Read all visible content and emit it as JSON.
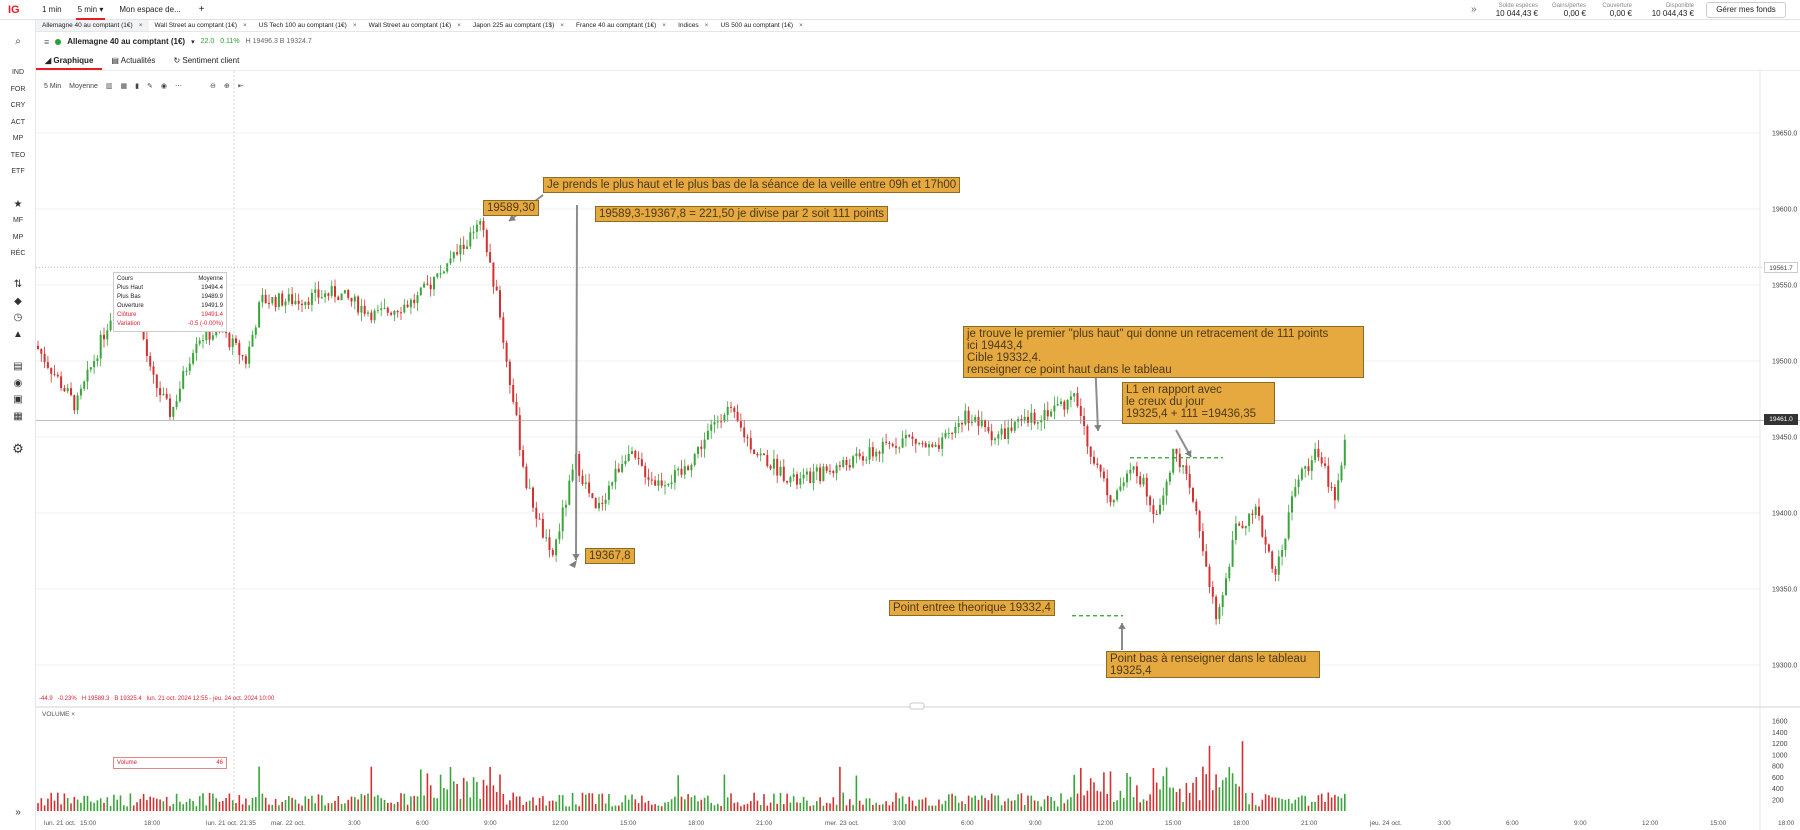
{
  "app": {
    "logo": "IG"
  },
  "topbar": {
    "timeframes": [
      "1 min",
      "5 min"
    ],
    "active_timeframe": "5 min",
    "workspace": "Mon espace de...",
    "add": "+",
    "more": "»",
    "account": [
      {
        "label": "Solde espèces",
        "value": "10 044,43 €"
      },
      {
        "label": "Gains/pertes",
        "value": "0,00 €"
      },
      {
        "label": "Couverture",
        "value": "0,00 €"
      },
      {
        "label": "Disponible",
        "value": "10 044,43 €"
      }
    ],
    "fund_button": "Gérer mes fonds"
  },
  "tabs": [
    {
      "label": "Allemagne 40 au comptant (1€)",
      "close": "×"
    },
    {
      "label": "Wall Street au comptant (1€)",
      "close": "×"
    },
    {
      "label": "US Tech 100 au comptant (1€)",
      "close": "×"
    },
    {
      "label": "Wall Street au comptant (1€)",
      "close": "×"
    },
    {
      "label": "Japon 225 au comptant (1$)",
      "close": "×"
    },
    {
      "label": "France 40 au comptant (1€)",
      "close": "×"
    },
    {
      "label": "Indices",
      "close": "×"
    },
    {
      "label": "US 500 au comptant (1€)",
      "close": "×"
    }
  ],
  "sidebar": {
    "items": [
      "IND",
      "FOR",
      "CRY",
      "ACT",
      "MP",
      "TEO",
      "ETF",
      "MF",
      "MP",
      "RÉC"
    ]
  },
  "instrument": {
    "name": "Allemagne 40 au comptant (1€)",
    "change": "22.0",
    "change_pct": "0.11%",
    "hl": "H 19496.3  B 19324.7"
  },
  "subtabs": [
    "Graphique",
    "Actualités",
    "Sentiment client"
  ],
  "toolbar": {
    "interval": "5 Min",
    "indicator": "Moyenne"
  },
  "tooltip": {
    "header_left": "Cours",
    "header_right": "Moyenne",
    "rows": [
      {
        "k": "Plus Haut",
        "v": "19494.4"
      },
      {
        "k": "Plus Bas",
        "v": "19489.9"
      },
      {
        "k": "Ouverture",
        "v": "19491.9"
      },
      {
        "k": "Clôture",
        "v": "19491.4"
      },
      {
        "k": "Variation",
        "v": "-0.5 (-0.00%)"
      }
    ]
  },
  "footer_info": "-44.9   -0.23%   H 19589.3   B 19325.4   lun. 21 oct. 2024 12:55 - jeu. 24 oct. 2024 10:00",
  "volume": {
    "title": "VOLUME",
    "close": "×",
    "label": "Volume",
    "value": "46"
  },
  "price_tags": {
    "dotted": "19561.7",
    "current": "19461.0"
  },
  "notes": {
    "n1": "Je prends le plus haut et le plus bas de la séance de la veille entre 09h et 17h00",
    "n2": "19589,30",
    "n3": "19589,3-19367,8 = 221,50 je divise par 2 soit 111 points",
    "n4": "19367,8",
    "n5": "je trouve le premier \"plus haut\" qui donne un retracement de 111 points\nici 19443,4\nCible 19332,4.\nrenseigner ce point haut dans le tableau",
    "n6": "L1 en rapport avec\nle creux du jour\n19325,4 + 111 =19436,35",
    "n7": "Point entree theorique 19332,4",
    "n8": "Point bas à renseigner dans le tableau\n19325,4"
  },
  "chart_data": {
    "type": "candlestick",
    "price_axis": {
      "ticks": [
        19300,
        19350,
        19400,
        19450,
        19500,
        19550,
        19600,
        19650
      ],
      "labels": [
        "19300.0",
        "19350.0",
        "19400.0",
        "19450.0",
        "19500.0",
        "19550.0",
        "19600.0",
        "19650.0"
      ]
    },
    "volume_axis": {
      "ticks": [
        200,
        400,
        600,
        800,
        1000,
        1200,
        1400,
        1600
      ],
      "labels": [
        "200",
        "400",
        "600",
        "800",
        "1000",
        "1200",
        "1400",
        "1600"
      ]
    },
    "time_labels": [
      "lun. 21 oct.",
      "15:00",
      "18:00",
      "lun. 21 oct. 21:35",
      "mar. 22 oct.",
      "3:00",
      "6:00",
      "9:00",
      "12:00",
      "15:00",
      "18:00",
      "21:00",
      "mer. 23 oct.",
      "3:00",
      "6:00",
      "9:00",
      "12:00",
      "15:00",
      "18:00",
      "21:00",
      "jeu. 24 oct.",
      "3:00",
      "6:00",
      "9:00",
      "12:00",
      "15:00",
      "18:00"
    ],
    "key_levels": {
      "high": 19589.3,
      "low": 19367.8,
      "entry": 19332.4,
      "day_low": 19325.4,
      "l1": 19436.35,
      "dotted": 19561.7,
      "current": 19461.0
    },
    "price_path": [
      [
        0,
        19510
      ],
      [
        40,
        19470
      ],
      [
        75,
        19530
      ],
      [
        95,
        19555
      ],
      [
        115,
        19490
      ],
      [
        135,
        19465
      ],
      [
        160,
        19515
      ],
      [
        185,
        19520
      ],
      [
        210,
        19500
      ],
      [
        225,
        19540
      ],
      [
        260,
        19540
      ],
      [
        300,
        19545
      ],
      [
        340,
        19530
      ],
      [
        380,
        19540
      ],
      [
        420,
        19570
      ],
      [
        445,
        19589.3
      ],
      [
        460,
        19545
      ],
      [
        490,
        19420
      ],
      [
        510,
        19380
      ],
      [
        515,
        19367.8
      ],
      [
        540,
        19435
      ],
      [
        560,
        19400
      ],
      [
        590,
        19440
      ],
      [
        620,
        19420
      ],
      [
        645,
        19425
      ],
      [
        690,
        19470
      ],
      [
        720,
        19440
      ],
      [
        760,
        19420
      ],
      [
        800,
        19430
      ],
      [
        840,
        19440
      ],
      [
        870,
        19450
      ],
      [
        900,
        19440
      ],
      [
        930,
        19465
      ],
      [
        960,
        19450
      ],
      [
        990,
        19460
      ],
      [
        1020,
        19470
      ],
      [
        1040,
        19475
      ],
      [
        1055,
        19440
      ],
      [
        1075,
        19410
      ],
      [
        1100,
        19430
      ],
      [
        1120,
        19400
      ],
      [
        1140,
        19443.4
      ],
      [
        1160,
        19400
      ],
      [
        1175,
        19350
      ],
      [
        1180,
        19325.4
      ],
      [
        1200,
        19390
      ],
      [
        1220,
        19400
      ],
      [
        1240,
        19360
      ],
      [
        1260,
        19420
      ],
      [
        1280,
        19440
      ],
      [
        1300,
        19410
      ],
      [
        1312,
        19461
      ]
    ]
  }
}
